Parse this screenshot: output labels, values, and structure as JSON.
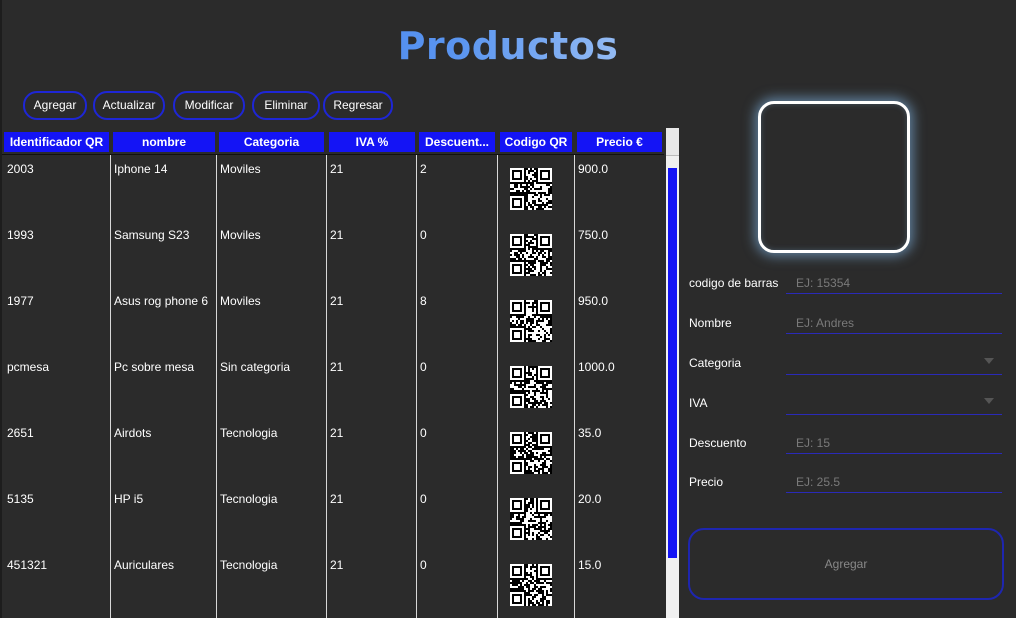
{
  "page": {
    "title": "Productos"
  },
  "toolbar": {
    "buttons": [
      {
        "label": "Agregar"
      },
      {
        "label": "Actualizar"
      },
      {
        "label": "Modificar"
      },
      {
        "label": "Eliminar"
      },
      {
        "label": "Regresar"
      }
    ]
  },
  "table": {
    "columns": [
      "Identificador QR",
      "nombre",
      "Categoria",
      "IVA %",
      "Descuent...",
      "Codigo QR",
      "Precio €"
    ],
    "rows": [
      {
        "id": "2003",
        "nombre": "Iphone 14",
        "categoria": "Moviles",
        "iva": "21",
        "descuento": "2",
        "precio": "900.0"
      },
      {
        "id": "1993",
        "nombre": "Samsung S23",
        "categoria": "Moviles",
        "iva": "21",
        "descuento": "0",
        "precio": "750.0"
      },
      {
        "id": "1977",
        "nombre": "Asus rog phone 6",
        "categoria": "Moviles",
        "iva": "21",
        "descuento": "8",
        "precio": "950.0"
      },
      {
        "id": "pcmesa",
        "nombre": "Pc sobre mesa",
        "categoria": "Sin categoria",
        "iva": "21",
        "descuento": "0",
        "precio": "1000.0"
      },
      {
        "id": "2651",
        "nombre": "Airdots",
        "categoria": "Tecnologia",
        "iva": "21",
        "descuento": "0",
        "precio": "35.0"
      },
      {
        "id": "5135",
        "nombre": "HP i5",
        "categoria": "Tecnologia",
        "iva": "21",
        "descuento": "0",
        "precio": "20.0"
      },
      {
        "id": "451321",
        "nombre": "Auriculares",
        "categoria": "Tecnologia",
        "iva": "21",
        "descuento": "0",
        "precio": "15.0"
      }
    ]
  },
  "form": {
    "codigo": {
      "label": "codigo de barras",
      "placeholder": "EJ: 15354"
    },
    "nombre": {
      "label": "Nombre",
      "placeholder": "EJ: Andres"
    },
    "categoria": {
      "label": "Categoria",
      "value": ""
    },
    "iva": {
      "label": "IVA",
      "value": ""
    },
    "descuento": {
      "label": "Descuento",
      "placeholder": "EJ: 15"
    },
    "precio": {
      "label": "Precio",
      "placeholder": "EJ: 25.5"
    },
    "submit_label": "Agregar"
  },
  "icons": {
    "qr": "qr-code-icon",
    "dropdown": "chevron-down-icon",
    "scroll_up": "arrow-up-icon"
  },
  "colors": {
    "accent": "#1414f5",
    "button_border": "#1e26d6",
    "background": "#2b2b2b"
  }
}
